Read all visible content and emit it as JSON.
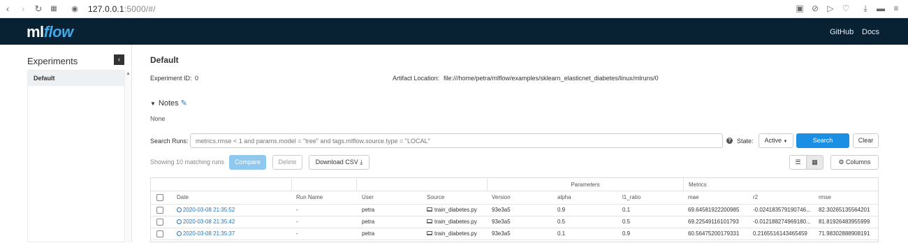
{
  "browser": {
    "url_host": "127.0.0.1",
    "url_path": ":5000/#/"
  },
  "header": {
    "logo_ml": "ml",
    "logo_flow": "flow",
    "links": [
      "GitHub",
      "Docs"
    ]
  },
  "sidebar": {
    "title": "Experiments",
    "collapse_glyph": "‹",
    "items": [
      {
        "label": "Default"
      }
    ]
  },
  "main": {
    "title": "Default",
    "experiment_id_label": "Experiment ID:",
    "experiment_id": "0",
    "artifact_label": "Artifact Location:",
    "artifact_location": "file:///home/petra/mlflow/examples/sklearn_elasticnet_diabetes/linux/mlruns/0",
    "notes_label": "Notes",
    "notes_value": "None",
    "search_label": "Search Runs:",
    "search_placeholder": "metrics.rmse < 1 and params.model = \"tree\" and tags.mlflow.source.type = \"LOCAL\"",
    "state_label": "State:",
    "state_value": "Active",
    "search_button": "Search",
    "clear_button": "Clear",
    "showing_text": "Showing 10 matching runs",
    "compare_button": "Compare",
    "delete_button": "Delete",
    "download_button": "Download CSV",
    "columns_button": "Columns"
  },
  "table": {
    "group_headers": {
      "parameters": "Parameters",
      "metrics": "Metrics"
    },
    "columns": [
      "Date",
      "Run Name",
      "User",
      "Source",
      "Version",
      "alpha",
      "l1_ratio",
      "mae",
      "r2",
      "rmse"
    ],
    "rows": [
      {
        "date": "2020-03-08 21:35:52",
        "run_name": "-",
        "user": "petra",
        "source": "train_diabetes.py",
        "version": "93e3a5",
        "alpha": "0.9",
        "l1_ratio": "0.1",
        "mae": "69.64581922200985",
        "r2": "-0.024183579190746...",
        "rmse": "82.30265135564201"
      },
      {
        "date": "2020-03-08 21:35:42",
        "run_name": "-",
        "user": "petra",
        "source": "train_diabetes.py",
        "version": "93e3a5",
        "alpha": "0.5",
        "l1_ratio": "0.5",
        "mae": "69.22549116101793",
        "r2": "-0.012188274969180...",
        "rmse": "81.81926483955999"
      },
      {
        "date": "2020-03-08 21:35:37",
        "run_name": "-",
        "user": "petra",
        "source": "train_diabetes.py",
        "version": "93e3a5",
        "alpha": "0.1",
        "l1_ratio": "0.9",
        "mae": "60.56475200179331",
        "r2": "0.2165516143465459",
        "rmse": "71.98302888908191"
      }
    ]
  },
  "colors": {
    "header_bg": "#082133",
    "accent": "#1a8fe3",
    "logo_flow": "#41a9e4",
    "link": "#2374bb"
  }
}
